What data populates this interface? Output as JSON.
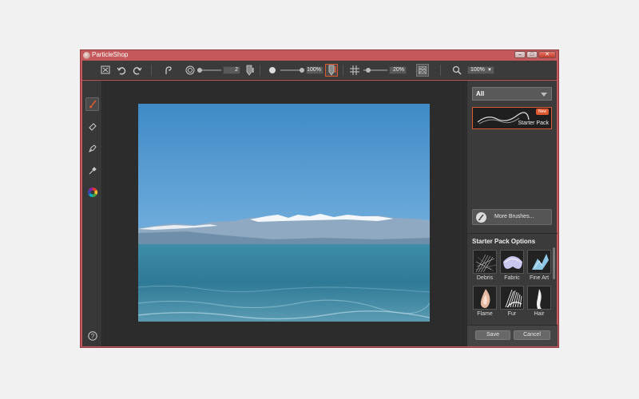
{
  "window": {
    "title": "ParticleShop",
    "controls": [
      "minimize",
      "maximize",
      "close"
    ]
  },
  "toolbar": {
    "icons": [
      "fit-screen-icon",
      "undo-icon",
      "redo-icon",
      "brush-pick-icon",
      "size-icon",
      "opacity-icon",
      "stylus-icon",
      "grid-icon",
      "texture-icon",
      "zoom-icon"
    ],
    "size_value": "2",
    "opacity_value": "100%",
    "grid_value": "20%",
    "zoom_value": "100%"
  },
  "tools": [
    "brush-tool-icon",
    "eraser-tool-icon",
    "pen-tool-icon",
    "eyedropper-tool-icon",
    "color-wheel-icon",
    "help-icon"
  ],
  "panel": {
    "filter": "All",
    "pack": {
      "badge": "New",
      "label": "Starter Pack"
    },
    "more_brushes": "More Brushes...",
    "options_title": "Starter Pack Options",
    "brushes": [
      "Debris",
      "Fabric",
      "Fine Art",
      "Flame",
      "Fur",
      "Hair"
    ],
    "save": "Save",
    "cancel": "Cancel"
  }
}
